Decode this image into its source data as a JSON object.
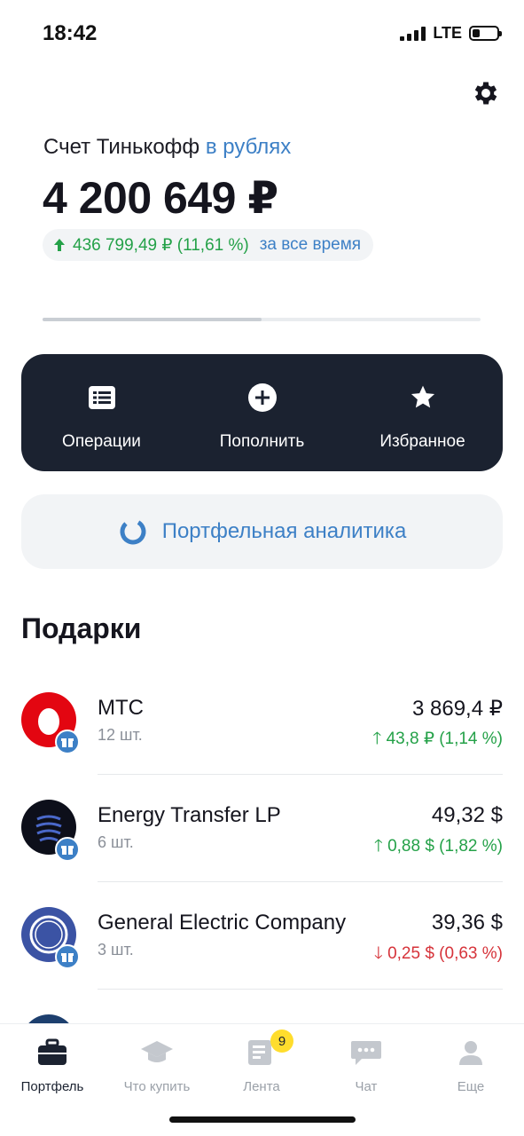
{
  "status_bar": {
    "time": "18:42",
    "network": "LTE",
    "battery_level": 0.3
  },
  "account": {
    "title_prefix": "Счет Тинькофф",
    "currency_selector": "в рублях",
    "balance": "4 200 649 ₽",
    "change_value": "436 799,49 ₽ (11,61 %)",
    "change_period": "за все время",
    "change_direction": "up"
  },
  "carousel_progress": 0.5,
  "actions": [
    {
      "label": "Операции",
      "icon": "list-icon"
    },
    {
      "label": "Пополнить",
      "icon": "plus-circle-icon"
    },
    {
      "label": "Избранное",
      "icon": "star-icon"
    }
  ],
  "analytics": {
    "label": "Портфельная аналитика",
    "icon": "donut-chart-icon"
  },
  "gifts": {
    "title": "Подарки",
    "items": [
      {
        "name": "МТС",
        "qty": "12 шт.",
        "price": "3 869,4 ₽",
        "change": "43,8 ₽ (1,14 %)",
        "direction": "up",
        "logo_color": "#e30611"
      },
      {
        "name": "Energy Transfer LP",
        "qty": "6 шт.",
        "price": "49,32 $",
        "change": "0,88 $ (1,82 %)",
        "direction": "up",
        "logo_color": "#0d0f1a"
      },
      {
        "name": "General Electric Company",
        "qty": "3 шт.",
        "price": "39,36 $",
        "change": "0,25 $ (0,63 %)",
        "direction": "down",
        "logo_color": "#3b53a4"
      }
    ]
  },
  "tabbar": {
    "tabs": [
      {
        "label": "Портфель",
        "icon": "briefcase-icon",
        "active": true
      },
      {
        "label": "Что купить",
        "icon": "graduation-cap-icon",
        "active": false
      },
      {
        "label": "Лента",
        "icon": "news-icon",
        "active": false,
        "badge": "9"
      },
      {
        "label": "Чат",
        "icon": "chat-bubble-icon",
        "active": false
      },
      {
        "label": "Еще",
        "icon": "user-icon",
        "active": false
      }
    ]
  },
  "colors": {
    "accent": "#3d80c6",
    "positive": "#24a148",
    "negative": "#d6333a",
    "dark_panel": "#1b2230",
    "badge": "#ffdd2d"
  }
}
